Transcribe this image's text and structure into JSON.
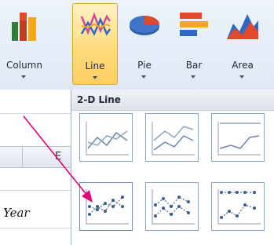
{
  "ribbon": {
    "buttons": [
      {
        "label": "Column",
        "icon": "column-chart-icon"
      },
      {
        "label": "Line",
        "icon": "line-chart-icon",
        "selected": true
      },
      {
        "label": "Pie",
        "icon": "pie-chart-icon"
      },
      {
        "label": "Bar",
        "icon": "bar-chart-icon"
      },
      {
        "label": "Area",
        "icon": "area-chart-icon"
      }
    ]
  },
  "dropdown": {
    "section_title": "2-D Line",
    "options_icons": [
      "line-icon",
      "stacked-line-icon",
      "100-percent-stacked-line-icon",
      "line-with-markers-icon",
      "stacked-line-with-markers-icon",
      "100-percent-stacked-line-with-markers-icon"
    ]
  },
  "sheet": {
    "column_letter": "E",
    "cell_text": "Year"
  },
  "colors": {
    "callout_arrow": "#e0007a",
    "selected_button": "#ffd97a",
    "chart_line": "#6b86a8"
  }
}
